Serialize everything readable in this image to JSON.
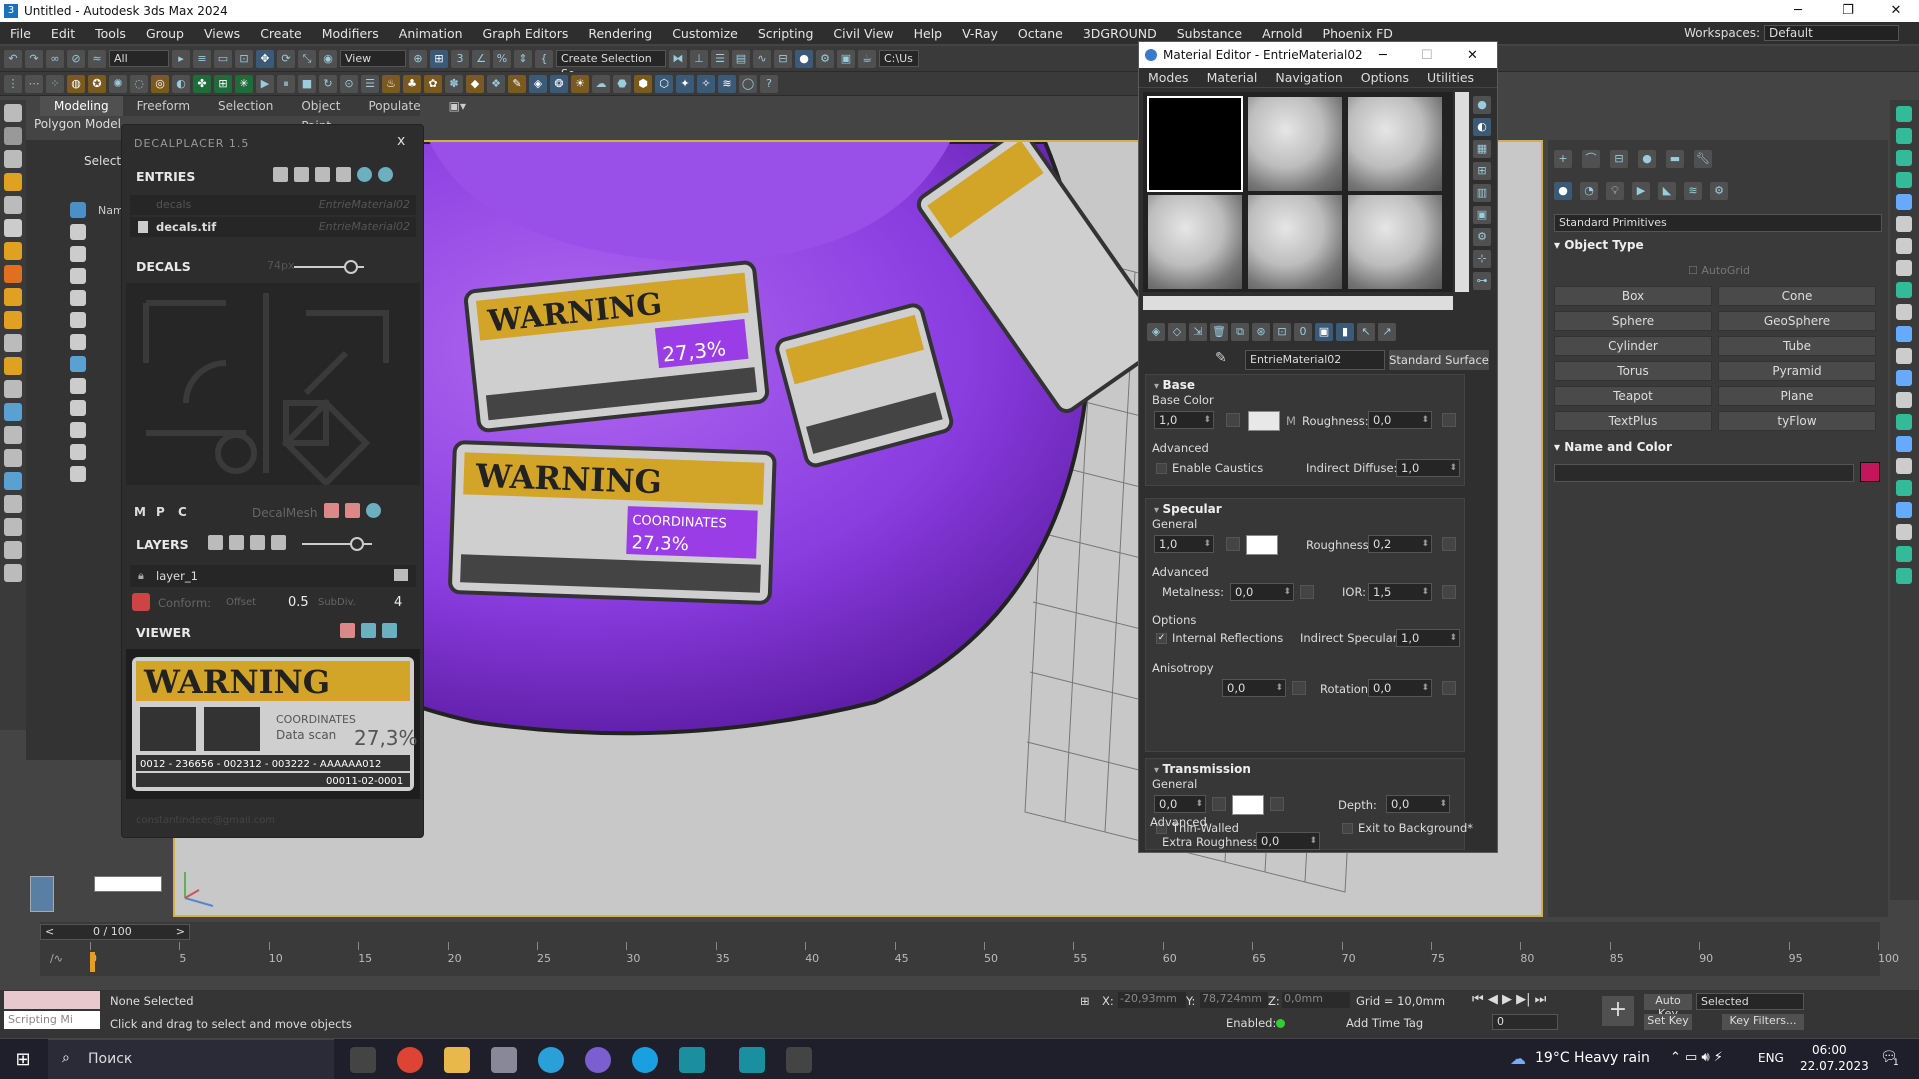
{
  "window": {
    "title": "Untitled - Autodesk 3ds Max 2024",
    "minimize": "─",
    "maximize": "❐",
    "close": "✕"
  },
  "menu": [
    "File",
    "Edit",
    "Tools",
    "Group",
    "Views",
    "Create",
    "Modifiers",
    "Animation",
    "Graph Editors",
    "Rendering",
    "Customize",
    "Scripting",
    "Civil View",
    "Help",
    "V-Ray",
    "Octane",
    "3DGROUND",
    "Substance",
    "Arnold",
    "Phoenix FD"
  ],
  "workspace": {
    "label": "Workspaces:",
    "value": "Default"
  },
  "toolbar": {
    "filter_all": "All",
    "view": "View",
    "selection_set": "Create Selection Se",
    "path": "C:\\Us"
  },
  "ribbon": {
    "tabs": [
      "Modeling",
      "Freeform",
      "Selection",
      "Object Paint",
      "Populate"
    ],
    "polygon": "Polygon Model"
  },
  "scene": {
    "select": "Select",
    "name_col": "Nam"
  },
  "decalplacer": {
    "title": "DECALPLACER 1.5",
    "entries_label": "ENTRIES",
    "entries": [
      {
        "name": "decals",
        "material": "EntrieMaterial02",
        "dim": true
      },
      {
        "name": "decals.tif",
        "material": "EntrieMaterial02",
        "dim": false
      }
    ],
    "decals_label": "DECALS",
    "decals_size": "74px",
    "mode_buttons": [
      "M",
      "P",
      "C"
    ],
    "decal_mesh": "DecalMesh",
    "layers_label": "LAYERS",
    "layer_name": "layer_1",
    "conform_label": "Conform:",
    "offset_label": "Offset",
    "offset_value": "0.5",
    "subdiv_label": "SubDiv.",
    "subdiv_value": "4",
    "viewer_label": "VIEWER",
    "email": "constantindeec@gmail.com",
    "close": "x"
  },
  "decal_art": {
    "warning": "WARNING",
    "coords": "COORDINATES",
    "scan": "Data scan",
    "pct": "27,3%",
    "code1": "0012 - 236656 - 002312 - 003222 - AAAAAA012",
    "code2": "00011-02-0001"
  },
  "material_editor": {
    "title": "Material Editor - EntrieMaterial02",
    "menu": [
      "Modes",
      "Material",
      "Navigation",
      "Options",
      "Utilities"
    ],
    "material_name": "EntrieMaterial02",
    "material_type": "Standard Surface",
    "base": {
      "header": "Base",
      "color_label": "Base Color",
      "weight": "1,0",
      "m": "M",
      "roughness_label": "Roughness:",
      "roughness": "0,0",
      "advanced": "Advanced",
      "caustics": "Enable Caustics",
      "indirect_label": "Indirect Diffuse:",
      "indirect": "1,0"
    },
    "specular": {
      "header": "Specular",
      "general": "General",
      "weight": "1,0",
      "roughness_label": "Roughness:",
      "roughness": "0,2",
      "advanced": "Advanced",
      "metalness_label": "Metalness:",
      "metalness": "0,0",
      "ior_label": "IOR:",
      "ior": "1,5",
      "options": "Options",
      "internal": "Internal Reflections",
      "indirect_label": "Indirect Specular:",
      "indirect": "1,0",
      "anisotropy": "Anisotropy",
      "aniso": "0,0",
      "rotation_label": "Rotation:",
      "rotation": "0,0"
    },
    "transmission": {
      "header": "Transmission",
      "general": "General",
      "weight": "0,0",
      "depth_label": "Depth:",
      "depth": "0,0",
      "thin": "Thin-Walled",
      "exit": "Exit to Background*",
      "advanced": "Advanced",
      "extra_label": "Extra Roughness:",
      "extra": "0,0"
    }
  },
  "command_panel": {
    "dropdown": "Standard Primitives",
    "object_type": "Object Type",
    "autogrid": "AutoGrid",
    "buttons": [
      "Box",
      "Cone",
      "Sphere",
      "GeoSphere",
      "Cylinder",
      "Tube",
      "Torus",
      "Pyramid",
      "Teapot",
      "Plane",
      "TextPlus",
      "tyFlow"
    ],
    "name_color": "Name and Color",
    "swatch": "#c2185b"
  },
  "timeline": {
    "frame": "0 / 100",
    "ticks": [
      "0",
      "5",
      "10",
      "15",
      "20",
      "25",
      "30",
      "35",
      "40",
      "45",
      "50",
      "55",
      "60",
      "65",
      "70",
      "75",
      "80",
      "85",
      "90",
      "95",
      "100"
    ]
  },
  "status": {
    "script": "Scripting Mi",
    "selection": "None Selected",
    "hint": "Click and drag to select and move objects",
    "x_label": "X:",
    "x": "-20,93mm",
    "y_label": "Y:",
    "y": "78,724mm",
    "z_label": "Z:",
    "z": "0,0mm",
    "grid": "Grid = 10,0mm",
    "enabled": "Enabled:",
    "timetag": "Add Time Tag",
    "autokey": "Auto Key",
    "setkey": "Set Key",
    "selected": "Selected",
    "keyfilters": "Key Filters...",
    "frame": "0"
  },
  "taskbar": {
    "search": "Поиск",
    "weather": "19°C  Heavy rain",
    "lang": "ENG",
    "time": "06:00",
    "date": "22.07.2023",
    "notif": "1"
  }
}
